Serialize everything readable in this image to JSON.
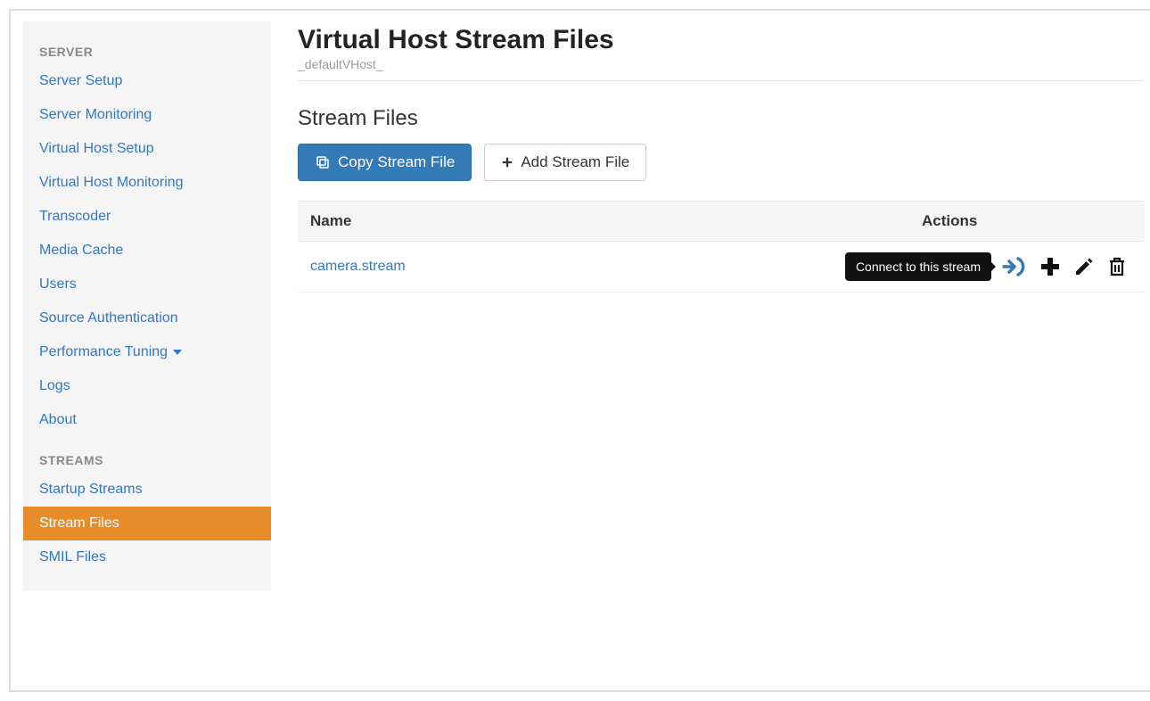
{
  "sidebar": {
    "groups": [
      {
        "header": "SERVER",
        "items": [
          {
            "label": "Server Setup",
            "active": false,
            "caret": false
          },
          {
            "label": "Server Monitoring",
            "active": false,
            "caret": false
          },
          {
            "label": "Virtual Host Setup",
            "active": false,
            "caret": false
          },
          {
            "label": "Virtual Host Monitoring",
            "active": false,
            "caret": false
          },
          {
            "label": "Transcoder",
            "active": false,
            "caret": false
          },
          {
            "label": "Media Cache",
            "active": false,
            "caret": false
          },
          {
            "label": "Users",
            "active": false,
            "caret": false
          },
          {
            "label": "Source Authentication",
            "active": false,
            "caret": false
          },
          {
            "label": "Performance Tuning",
            "active": false,
            "caret": true
          },
          {
            "label": "Logs",
            "active": false,
            "caret": false
          },
          {
            "label": "About",
            "active": false,
            "caret": false
          }
        ]
      },
      {
        "header": "STREAMS",
        "items": [
          {
            "label": "Startup Streams",
            "active": false,
            "caret": false
          },
          {
            "label": "Stream Files",
            "active": true,
            "caret": false
          },
          {
            "label": "SMIL Files",
            "active": false,
            "caret": false
          }
        ]
      }
    ]
  },
  "page": {
    "title": "Virtual Host Stream Files",
    "subtitle": "_defaultVHost_"
  },
  "section": {
    "title": "Stream Files",
    "copy_label": "Copy Stream File",
    "add_label": "Add Stream File"
  },
  "table": {
    "col_name": "Name",
    "col_actions": "Actions",
    "rows": [
      {
        "name": "camera.stream",
        "tooltip": "Connect to this stream"
      }
    ]
  }
}
